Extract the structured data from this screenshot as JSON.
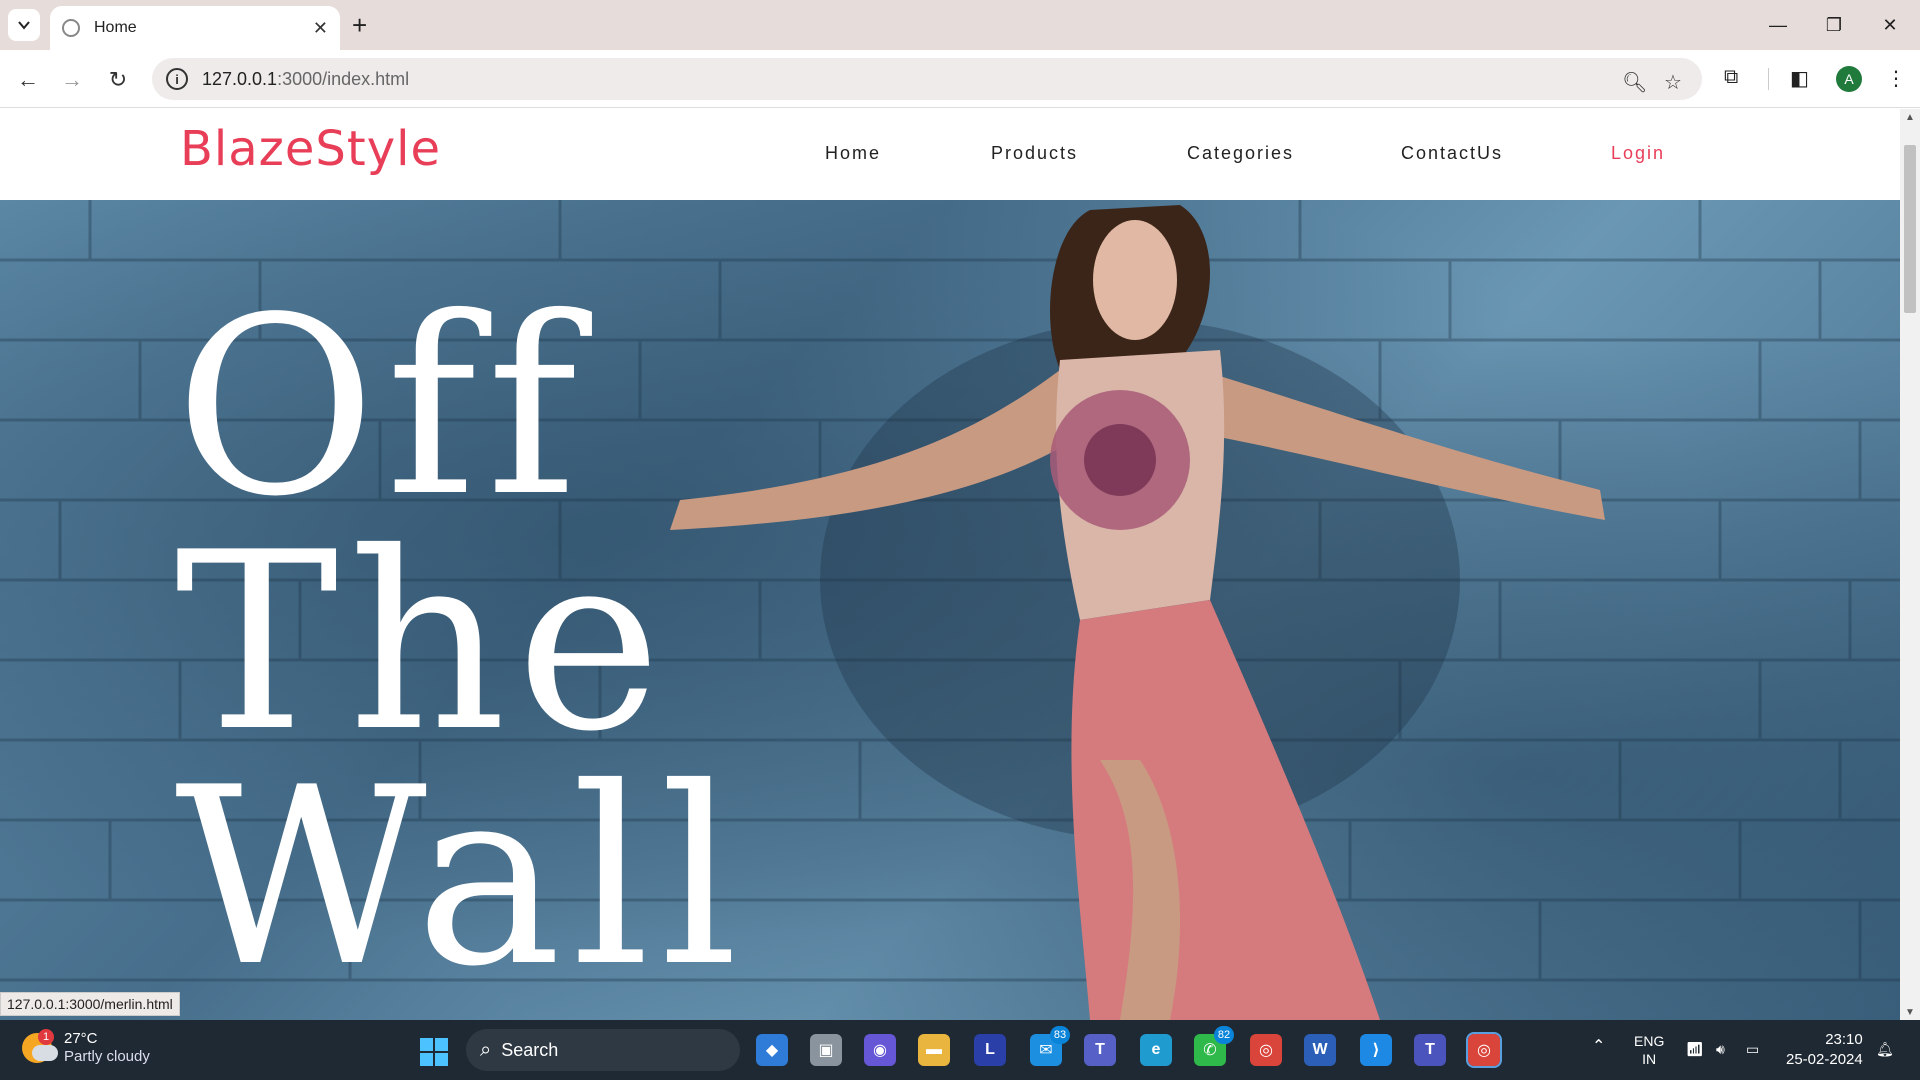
{
  "browser": {
    "tab_title": "Home",
    "url_host": "127.0.0.1",
    "url_rest": ":3000/index.html",
    "profile_initial": "A"
  },
  "site": {
    "logo": "BlazeStyle",
    "nav": [
      "Home",
      "Products",
      "Categories",
      "ContactUs",
      "Login"
    ],
    "hero_lines": [
      "Off",
      "The",
      "Wall"
    ],
    "brand_color": "#e83e58"
  },
  "status_url": "127.0.0.1:3000/merlin.html",
  "taskbar": {
    "weather_temp": "27°C",
    "weather_cond": "Partly cloudy",
    "weather_badge": "1",
    "search_label": "Search",
    "mail_count": "83",
    "whatsapp_count": "82",
    "lang_top": "ENG",
    "lang_bottom": "IN",
    "time": "23:10",
    "date": "25-02-2024"
  }
}
